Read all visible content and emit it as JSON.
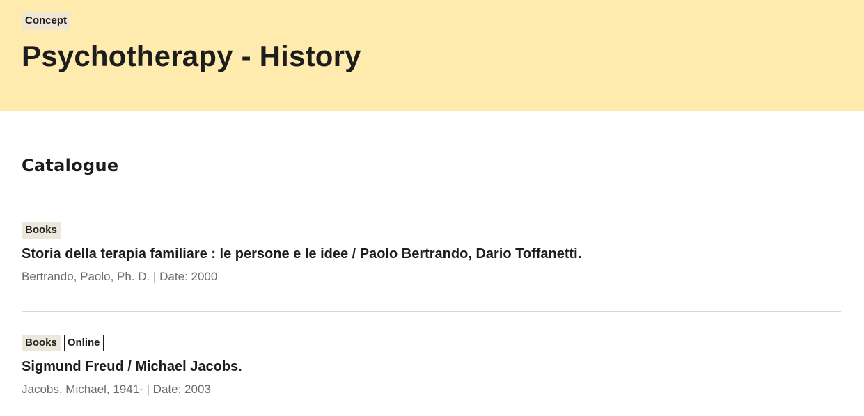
{
  "header": {
    "tag": "Concept",
    "title": "Psychotherapy - History",
    "background_color": "#ffebad"
  },
  "catalogue": {
    "heading": "Catalogue",
    "results": [
      {
        "tags": [
          "Books"
        ],
        "title": "Storia della terapia familiare : le persone e le idee / Paolo Bertrando, Dario Toffanetti.",
        "meta": "Bertrando, Paolo, Ph. D. | Date: 2000"
      },
      {
        "tags": [
          "Books",
          "Online"
        ],
        "title": "Sigmund Freud / Michael Jacobs.",
        "meta": "Jacobs, Michael, 1941- | Date: 2003"
      }
    ]
  }
}
